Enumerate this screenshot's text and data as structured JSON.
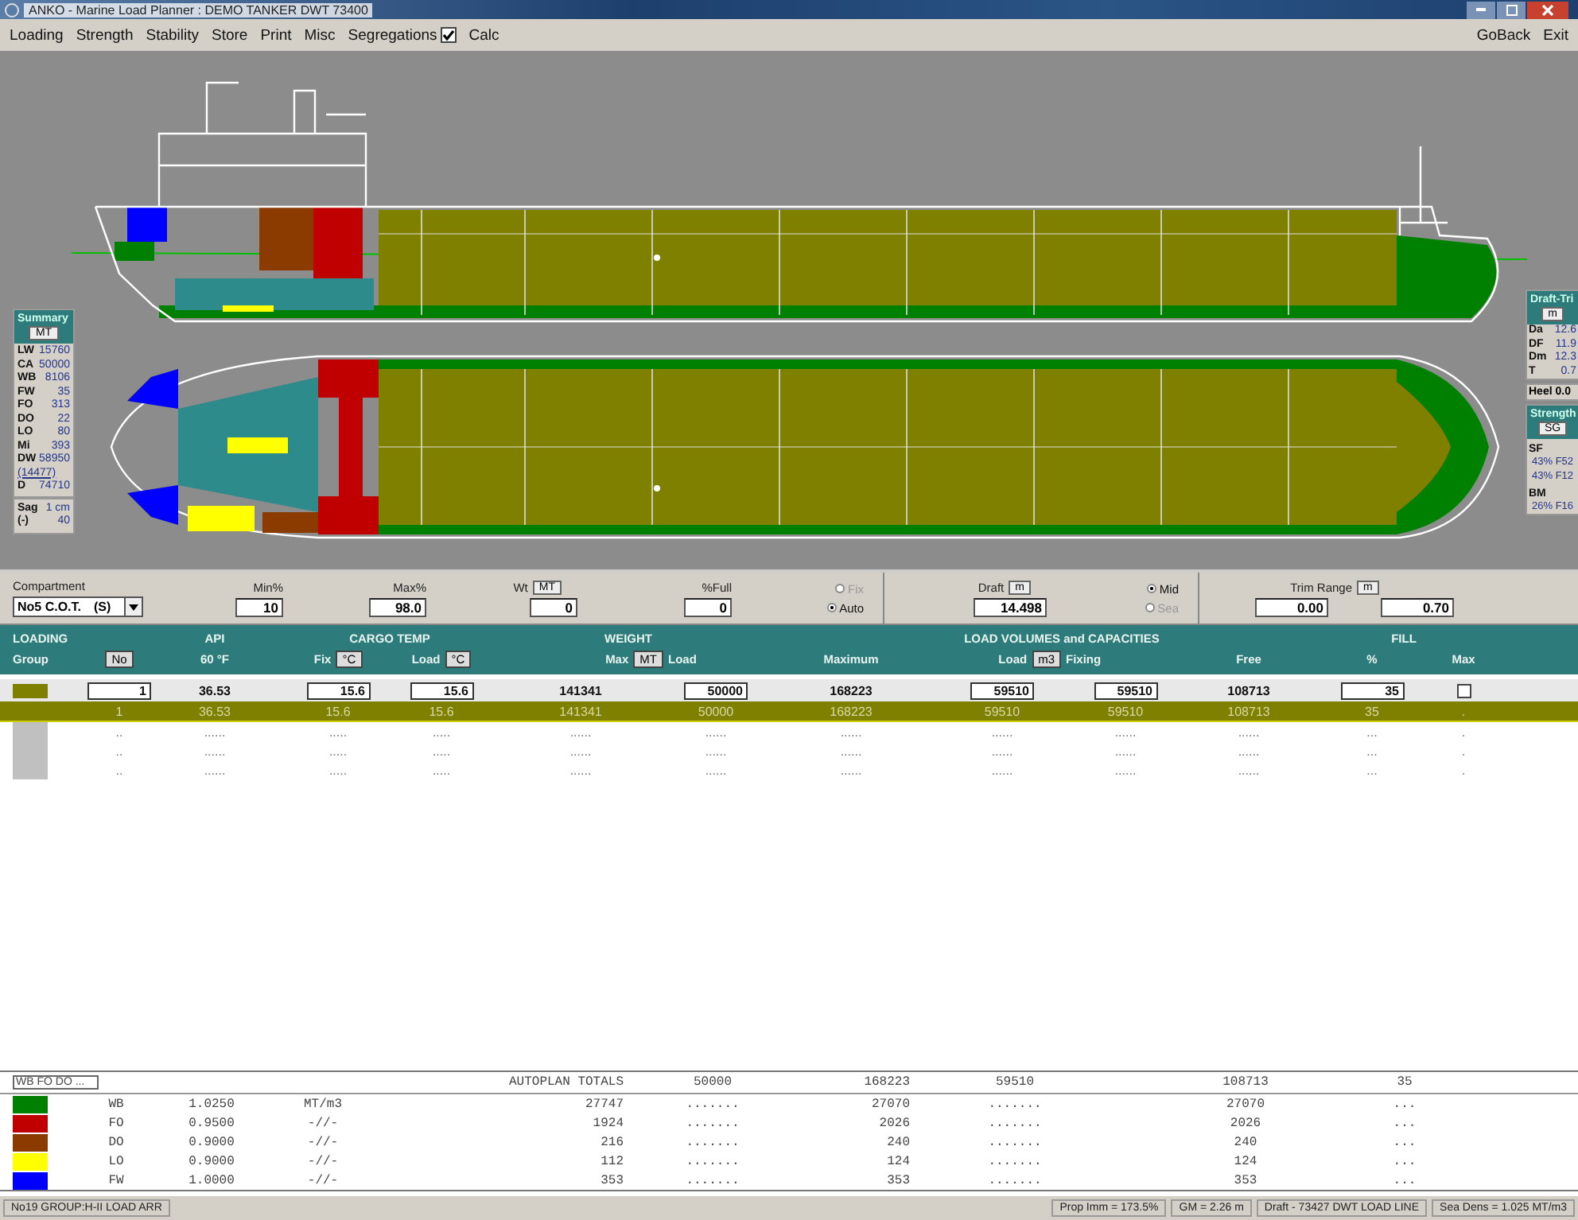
{
  "window": {
    "title": "ANKO - Marine Load Planner : DEMO TANKER DWT 73400"
  },
  "menu": {
    "items": [
      {
        "label": "Loading",
        "kind": "item"
      },
      {
        "label": "Strength",
        "kind": "item"
      },
      {
        "label": "Stability",
        "kind": "item"
      },
      {
        "label": "Store",
        "kind": "item"
      },
      {
        "label": "Print",
        "kind": "item"
      },
      {
        "label": "Misc",
        "kind": "item"
      },
      {
        "label": "Segregations",
        "kind": "check",
        "checked": true
      },
      {
        "label": "Calc",
        "kind": "item"
      }
    ],
    "right": [
      "GoBack",
      "Exit"
    ]
  },
  "summary": {
    "title": "Summary",
    "unit": "MT",
    "rows": [
      {
        "label": "LW",
        "value": "15760"
      },
      {
        "label": "CA",
        "value": "50000"
      },
      {
        "label": "WB",
        "value": "8106"
      },
      {
        "label": "FW",
        "value": "35"
      },
      {
        "label": "FO",
        "value": "313"
      },
      {
        "label": "DO",
        "value": "22"
      },
      {
        "label": "LO",
        "value": "80"
      },
      {
        "label": "Mi",
        "value": "393"
      },
      {
        "label": "DW",
        "value": "58950"
      },
      {
        "kind": "link",
        "value": "(14477)"
      },
      {
        "label": "D",
        "value": "74710"
      }
    ],
    "sag": {
      "label": "Sag",
      "sign": "(-)",
      "unit": "1 cm",
      "value": "40"
    }
  },
  "draft_trim": {
    "title": "Draft-Tri",
    "unit": "m",
    "rows": [
      {
        "label": "Da",
        "value": "12.6"
      },
      {
        "label": "DF",
        "value": "11.9"
      },
      {
        "label": "Dm",
        "value": "12.3"
      },
      {
        "label": "T",
        "value": "0.7"
      }
    ],
    "heel": "Heel 0.0"
  },
  "strength": {
    "title": "Strength",
    "unit": "SG",
    "sections": [
      {
        "label": "SF",
        "values": [
          "43% F52",
          "43% F12"
        ]
      },
      {
        "label": "BM",
        "values": [
          "26% F16"
        ]
      }
    ]
  },
  "compartment": {
    "label": "Compartment",
    "name": "No5 C.O.T.",
    "side": "(S)",
    "min_label": "Min%",
    "min": "10",
    "max_label": "Max%",
    "max": "98.0",
    "wt_label": "Wt",
    "wt_unit": "MT",
    "wt": "0",
    "full_label": "%Full",
    "full": "0",
    "mode": [
      {
        "label": "Fix",
        "selected": false,
        "disabled": true
      },
      {
        "label": "Auto",
        "selected": true,
        "disabled": false
      }
    ],
    "draft_label": "Draft",
    "draft_unit": "m",
    "draft": "14.498",
    "draft_mode": [
      {
        "label": "Mid",
        "selected": true,
        "disabled": false
      },
      {
        "label": "Sea",
        "selected": false,
        "disabled": true
      }
    ],
    "trim_label": "Trim Range",
    "trim_unit": "m",
    "trim_from": "0.00",
    "trim_to": "0.70"
  },
  "table": {
    "headings": [
      "LOADING",
      "API",
      "CARGO TEMP",
      "WEIGHT",
      "LOAD VOLUMES and CAPACITIES",
      "FILL"
    ],
    "group_label": "Group",
    "columns": [
      {
        "label": "No",
        "kind": "button"
      },
      {
        "label": "60 °F",
        "kind": "text"
      },
      {
        "label": "Fix",
        "unit": "°C",
        "kind": "text"
      },
      {
        "label": "Load",
        "unit": "°C",
        "kind": "text"
      },
      {
        "label": "Max",
        "unit": "MT",
        "kind": "text"
      },
      {
        "label": "Load",
        "kind": "text"
      },
      {
        "label": "Maximum",
        "kind": "text"
      },
      {
        "label": "Load",
        "unit": "m3",
        "kind": "text"
      },
      {
        "label": "Fixing",
        "kind": "text"
      },
      {
        "label": "Free",
        "kind": "text"
      },
      {
        "label": "%",
        "kind": "text"
      },
      {
        "label": "Max",
        "kind": "text"
      }
    ],
    "rows": [
      {
        "kind": "edit",
        "selected": false,
        "color": "#808000",
        "cells": [
          "1",
          "36.53",
          "15.6",
          "15.6",
          "141341",
          "50000",
          "168223",
          "59510",
          "59510",
          "108713",
          "35"
        ],
        "max_checked": false
      },
      {
        "kind": "plain",
        "selected": true,
        "cells": [
          "1",
          "36.53",
          "15.6",
          "15.6",
          "141341",
          "50000",
          "168223",
          "59510",
          "59510",
          "108713",
          "35",
          "."
        ]
      },
      {
        "kind": "plain",
        "selected": false,
        "color": "#c0c0c0",
        "cells": [
          "..",
          "......",
          ".....",
          ".....",
          "......",
          "......",
          "......",
          "......",
          "......",
          "......",
          "...",
          "."
        ]
      },
      {
        "kind": "plain",
        "selected": false,
        "color": "#c0c0c0",
        "cells": [
          "..",
          "......",
          ".....",
          ".....",
          "......",
          "......",
          "......",
          "......",
          "......",
          "......",
          "...",
          "."
        ]
      },
      {
        "kind": "plain",
        "selected": false,
        "color": "#c0c0c0",
        "cells": [
          "..",
          "......",
          ".....",
          ".....",
          "......",
          "......",
          "......",
          "......",
          "......",
          "......",
          "...",
          "."
        ]
      }
    ]
  },
  "totals": {
    "filter": "WB FO DO ...",
    "label": "AUTOPLAN TOTALS",
    "values": [
      "50000",
      "168223",
      "59510",
      "108713",
      "35"
    ],
    "rows": [
      {
        "color": "#008000",
        "name": "WB",
        "density": "1.0250",
        "unit": "MT/m3",
        "weight": "27747",
        "load": ".......",
        "maximum": "27070",
        "volume": ".......",
        "free": "27070",
        "fill": "..."
      },
      {
        "color": "#c00000",
        "name": "FO",
        "density": "0.9500",
        "unit": "-//-",
        "weight": "1924",
        "load": ".......",
        "maximum": "2026",
        "volume": ".......",
        "free": "2026",
        "fill": "..."
      },
      {
        "color": "#8b3a00",
        "name": "DO",
        "density": "0.9000",
        "unit": "-//-",
        "weight": "216",
        "load": ".......",
        "maximum": "240",
        "volume": ".......",
        "free": "240",
        "fill": "..."
      },
      {
        "color": "#ffff00",
        "name": "LO",
        "density": "0.9000",
        "unit": "-//-",
        "weight": "112",
        "load": ".......",
        "maximum": "124",
        "volume": ".......",
        "free": "124",
        "fill": "..."
      },
      {
        "color": "#0000ff",
        "name": "FW",
        "density": "1.0000",
        "unit": "-//-",
        "weight": "353",
        "load": ".......",
        "maximum": "353",
        "volume": ".......",
        "free": "353",
        "fill": "..."
      }
    ]
  },
  "status_bar": {
    "left": "No19 GROUP:H-II LOAD ARR",
    "right": [
      "Prop Imm = 173.5%",
      "GM = 2.26 m",
      "Draft - 73427 DWT LOAD LINE",
      "Sea Dens = 1.025 MT/m3"
    ]
  }
}
